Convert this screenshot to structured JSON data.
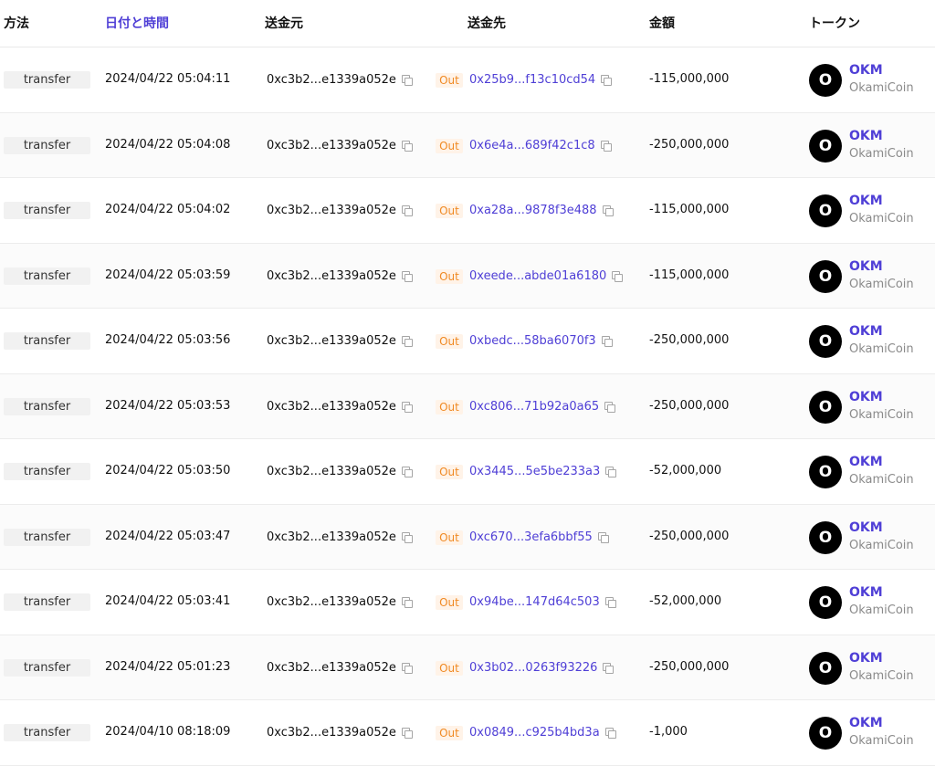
{
  "headers": {
    "method": "方法",
    "time": "日付と時間",
    "from": "送金元",
    "to": "送金先",
    "amount": "金額",
    "token": "トークン"
  },
  "colors": {
    "accent": "#4f3fd6",
    "out_badge_text": "#f08a24",
    "out_badge_bg": "#fff3e8"
  },
  "rows": [
    {
      "method": "transfer",
      "time": "2024/04/22 05:04:11",
      "from": "0xc3b2...e1339a052e",
      "direction": "Out",
      "to": "0x25b9...f13c10cd54",
      "amount": "-115,000,000",
      "token_logo": "O",
      "token_symbol": "OKM",
      "token_name": "OkamiCoin"
    },
    {
      "method": "transfer",
      "time": "2024/04/22 05:04:08",
      "from": "0xc3b2...e1339a052e",
      "direction": "Out",
      "to": "0x6e4a...689f42c1c8",
      "amount": "-250,000,000",
      "token_logo": "O",
      "token_symbol": "OKM",
      "token_name": "OkamiCoin"
    },
    {
      "method": "transfer",
      "time": "2024/04/22 05:04:02",
      "from": "0xc3b2...e1339a052e",
      "direction": "Out",
      "to": "0xa28a...9878f3e488",
      "amount": "-115,000,000",
      "token_logo": "O",
      "token_symbol": "OKM",
      "token_name": "OkamiCoin"
    },
    {
      "method": "transfer",
      "time": "2024/04/22 05:03:59",
      "from": "0xc3b2...e1339a052e",
      "direction": "Out",
      "to": "0xeede...abde01a6180",
      "amount": "-115,000,000",
      "token_logo": "O",
      "token_symbol": "OKM",
      "token_name": "OkamiCoin"
    },
    {
      "method": "transfer",
      "time": "2024/04/22 05:03:56",
      "from": "0xc3b2...e1339a052e",
      "direction": "Out",
      "to": "0xbedc...58ba6070f3",
      "amount": "-250,000,000",
      "token_logo": "O",
      "token_symbol": "OKM",
      "token_name": "OkamiCoin"
    },
    {
      "method": "transfer",
      "time": "2024/04/22 05:03:53",
      "from": "0xc3b2...e1339a052e",
      "direction": "Out",
      "to": "0xc806...71b92a0a65",
      "amount": "-250,000,000",
      "token_logo": "O",
      "token_symbol": "OKM",
      "token_name": "OkamiCoin"
    },
    {
      "method": "transfer",
      "time": "2024/04/22 05:03:50",
      "from": "0xc3b2...e1339a052e",
      "direction": "Out",
      "to": "0x3445...5e5be233a3",
      "amount": "-52,000,000",
      "token_logo": "O",
      "token_symbol": "OKM",
      "token_name": "OkamiCoin"
    },
    {
      "method": "transfer",
      "time": "2024/04/22 05:03:47",
      "from": "0xc3b2...e1339a052e",
      "direction": "Out",
      "to": "0xc670...3efa6bbf55",
      "amount": "-250,000,000",
      "token_logo": "O",
      "token_symbol": "OKM",
      "token_name": "OkamiCoin"
    },
    {
      "method": "transfer",
      "time": "2024/04/22 05:03:41",
      "from": "0xc3b2...e1339a052e",
      "direction": "Out",
      "to": "0x94be...147d64c503",
      "amount": "-52,000,000",
      "token_logo": "O",
      "token_symbol": "OKM",
      "token_name": "OkamiCoin"
    },
    {
      "method": "transfer",
      "time": "2024/04/22 05:01:23",
      "from": "0xc3b2...e1339a052e",
      "direction": "Out",
      "to": "0x3b02...0263f93226",
      "amount": "-250,000,000",
      "token_logo": "O",
      "token_symbol": "OKM",
      "token_name": "OkamiCoin"
    },
    {
      "method": "transfer",
      "time": "2024/04/10 08:18:09",
      "from": "0xc3b2...e1339a052e",
      "direction": "Out",
      "to": "0x0849...c925b4bd3a",
      "amount": "-1,000",
      "token_logo": "O",
      "token_symbol": "OKM",
      "token_name": "OkamiCoin"
    }
  ]
}
